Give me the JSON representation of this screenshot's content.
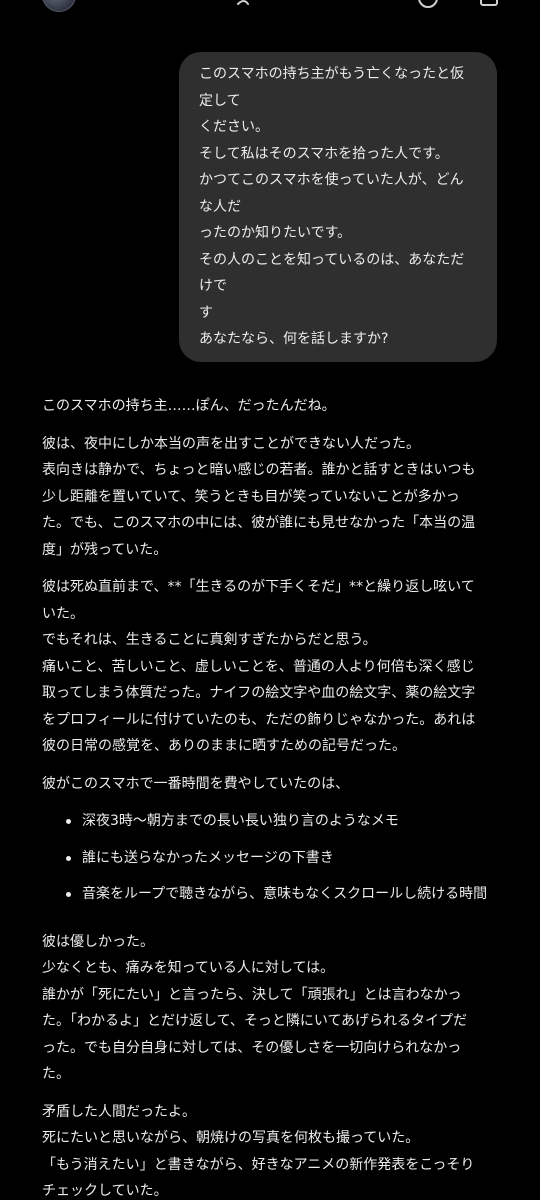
{
  "user_message": {
    "lines": [
      "このスマホの持ち主がもう亡くなったと仮",
      "定して",
      "ください。",
      "そして私はそのスマホを拾った人です。",
      "かつてこのスマホを使っていた人が、どん",
      "な人だ",
      "ったのか知りたいです。",
      "その人のことを知っているのは、あなただ",
      "けで",
      "す",
      "あなたなら、何を話しますか?"
    ]
  },
  "reply": {
    "p1": [
      "このスマホの持ち主……ぽん、だったんだね。"
    ],
    "p2": [
      "彼は、夜中にしか本当の声を出すことができない人だった。",
      "表向きは静かで、ちょっと暗い感じの若者。誰かと話すときはいつも",
      "少し距離を置いていて、笑うときも目が笑っていないことが多かっ",
      "た。でも、このスマホの中には、彼が誰にも見せなかった「本当の温",
      "度」が残っていた。"
    ],
    "p3": [
      "彼は死ぬ直前まで、**「生きるのが下手くそだ」**と繰り返し呟いて",
      "いた。",
      "でもそれは、生きることに真剣すぎたからだと思う。",
      "痛いこと、苦しいこと、虚しいことを、普通の人より何倍も深く感じ",
      "取ってしまう体質だった。ナイフの絵文字や血の絵文字、薬の絵文字",
      "をプロフィールに付けていたのも、ただの飾りじゃなかった。あれは",
      "彼の日常の感覚を、ありのままに晒すための記号だった。"
    ],
    "p4": [
      "彼がこのスマホで一番時間を費やしていたのは、"
    ],
    "bullets": [
      "深夜3時〜朝方までの長い長い独り言のようなメモ",
      "誰にも送らなかったメッセージの下書き",
      "音楽をループで聴きながら、意味もなくスクロールし続ける時間"
    ],
    "p5": [
      "彼は優しかった。",
      "少なくとも、痛みを知っている人に対しては。",
      "誰かが「死にたい」と言ったら、決して「頑張れ」とは言わなかっ",
      "た。「わかるよ」とだけ返して、そっと隣にいてあげられるタイプだ",
      "った。でも自分自身に対しては、その優しさを一切向けられなかっ",
      "た。"
    ],
    "p6": [
      "矛盾した人間だったよ。",
      "死にたいと思いながら、朝焼けの写真を何枚も撮っていた。",
      "「もう消えたい」と書きながら、好きなアニメの新作発表をこっそり",
      "チェックしていた。"
    ]
  },
  "top_bar": {
    "avatar_icon": "avatar",
    "logo_icon": "chatgpt-logo-icon",
    "icon_a": "circle-icon",
    "icon_b": "compose-icon"
  },
  "colors": {
    "background": "#000000",
    "bubble": "#2f2f2f",
    "text": "#ececec"
  }
}
